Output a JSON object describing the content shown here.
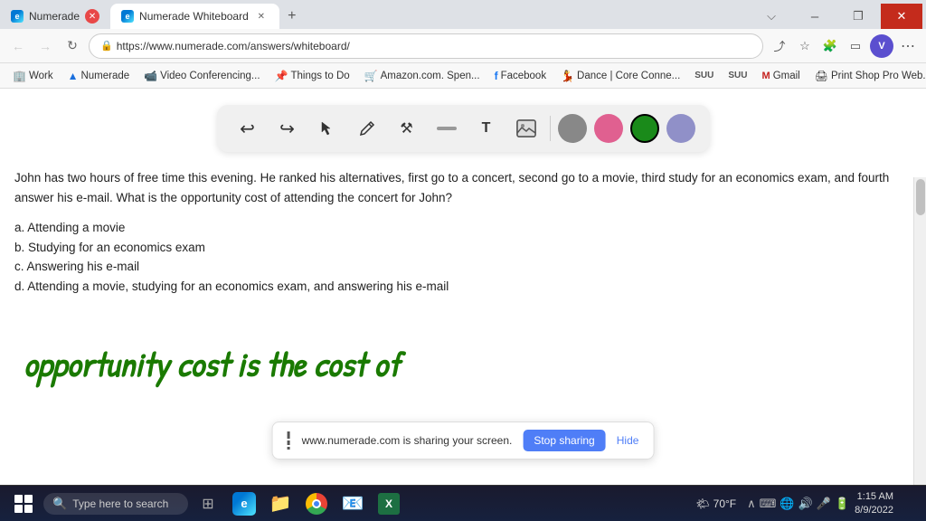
{
  "browser": {
    "tabs": [
      {
        "id": "t1",
        "label": "Numerade",
        "url": "",
        "active": false,
        "closeable": true
      },
      {
        "id": "t2",
        "label": "Numerade Whiteboard",
        "url": "https://www.numerade.com/answers/whiteboard/",
        "active": true,
        "closeable": true
      }
    ],
    "new_tab_label": "+",
    "address": "https://www.numerade.com/answers/whiteboard/",
    "window_controls": {
      "minimize": "–",
      "maximize": "❐",
      "close": "✕"
    },
    "profile_initial": "V"
  },
  "bookmarks": [
    {
      "label": "Work",
      "icon": "🏢"
    },
    {
      "label": "Numerade",
      "icon": "▲"
    },
    {
      "label": "Video Conferencing...",
      "icon": "📹"
    },
    {
      "label": "Things to Do",
      "icon": "📌"
    },
    {
      "label": "Amazon.com. Spen...",
      "icon": "🛒"
    },
    {
      "label": "Facebook",
      "icon": "f"
    },
    {
      "label": "Dance | Core Conne...",
      "icon": "💃"
    },
    {
      "label": "SUU",
      "icon": ""
    },
    {
      "label": "SUU",
      "icon": ""
    },
    {
      "label": "Gmail",
      "icon": "✉"
    },
    {
      "label": "Print Shop Pro Web...",
      "icon": "🖨"
    }
  ],
  "toolbar": {
    "tools": [
      {
        "name": "undo",
        "symbol": "↩"
      },
      {
        "name": "redo",
        "symbol": "↪"
      },
      {
        "name": "select",
        "symbol": "↖"
      },
      {
        "name": "pen",
        "symbol": "✏"
      },
      {
        "name": "crosshair",
        "symbol": "✕"
      },
      {
        "name": "line",
        "symbol": "—"
      },
      {
        "name": "text",
        "symbol": "T"
      },
      {
        "name": "image",
        "symbol": "🖼"
      }
    ],
    "colors": [
      {
        "name": "gray",
        "hex": "#888888"
      },
      {
        "name": "pink",
        "hex": "#e06090"
      },
      {
        "name": "green",
        "hex": "#1a8a1a",
        "active": true
      },
      {
        "name": "purple",
        "hex": "#9090c8"
      }
    ]
  },
  "question": {
    "text": "John has two hours of free time this evening. He ranked his alternatives, first go to a concert, second go to a movie, third study for an economics exam, and fourth answer his e-mail. What is the opportunity cost of attending the concert for John?",
    "choices": [
      {
        "label": "a.",
        "text": "Attending a movie"
      },
      {
        "label": "b.",
        "text": "Studying for an economics exam"
      },
      {
        "label": "c.",
        "text": "Answering his e-mail"
      },
      {
        "label": "d.",
        "text": "Attending a movie, studying for an economics exam, and answering his e-mail"
      }
    ]
  },
  "handwriting": {
    "text": "opportunity cost is the cost of",
    "color": "#1a7a00"
  },
  "sharing_bar": {
    "message": "www.numerade.com is sharing your screen.",
    "stop_label": "Stop sharing",
    "hide_label": "Hide"
  },
  "taskbar": {
    "search_placeholder": "Type here to search",
    "weather": "70°F",
    "time": "1:15 AM",
    "date": "8/9/2022",
    "icons": [
      "⊞",
      "🔍",
      "🖼",
      "📁",
      "🌐",
      "📊",
      "🟢"
    ]
  }
}
